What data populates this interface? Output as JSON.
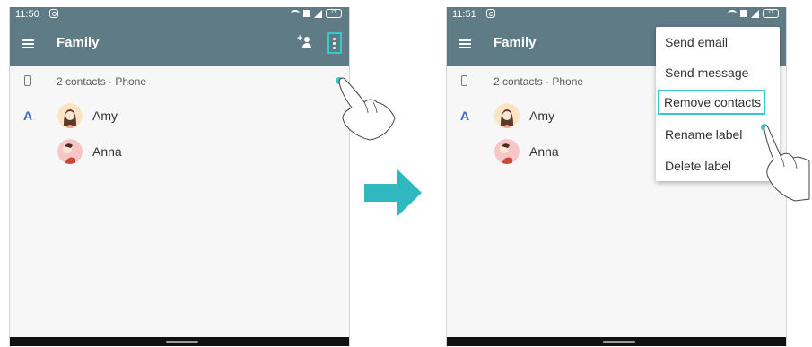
{
  "steps": [
    {
      "status_bar": {
        "time": "11:50",
        "battery": "71"
      },
      "toolbar": {
        "title": "Family"
      },
      "summary": "2 contacts · Phone",
      "contacts": [
        {
          "section_letter": "A",
          "name": "Amy"
        },
        {
          "section_letter": "",
          "name": "Anna"
        }
      ]
    },
    {
      "status_bar": {
        "time": "11:51",
        "battery": "71"
      },
      "toolbar": {
        "title": "Family"
      },
      "summary": "2 contacts · Phone",
      "contacts": [
        {
          "section_letter": "A",
          "name": "Amy"
        },
        {
          "section_letter": "",
          "name": "Anna"
        }
      ],
      "overflow_menu": [
        "Send email",
        "Send message",
        "Remove contacts",
        "Rename label",
        "Delete label"
      ]
    }
  ],
  "colors": {
    "toolbar": "#5f7b86",
    "highlight": "#38c9cc",
    "section_letter": "#3d6bc6",
    "arrow": "#2fb8bf"
  },
  "icons": [
    "menu-icon",
    "add-contact-icon",
    "overflow-menu-icon",
    "phone-icon",
    "camera-icon",
    "wifi-icon",
    "signal-icon",
    "battery-icon",
    "tap-hand-icon",
    "next-step-arrow-icon"
  ]
}
